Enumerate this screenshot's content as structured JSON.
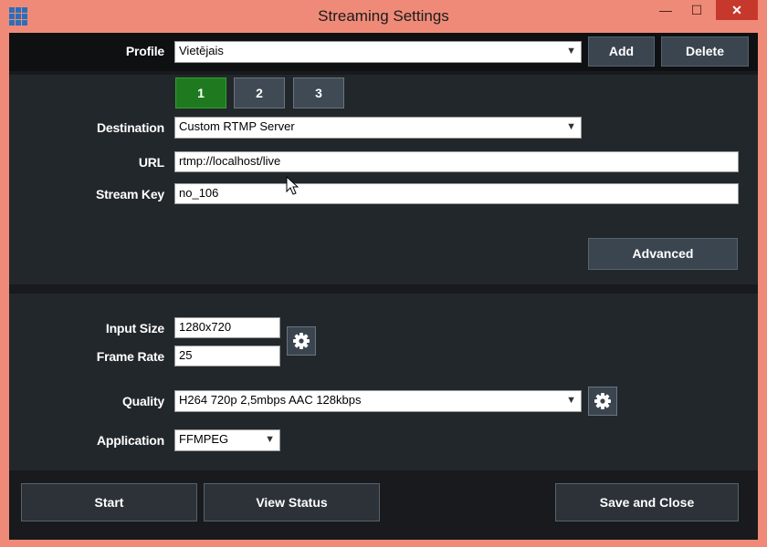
{
  "window": {
    "title": "Streaming Settings",
    "minimize_glyph": "—",
    "maximize_glyph": "☐",
    "close_glyph": "✕"
  },
  "profile": {
    "label": "Profile",
    "value": "Vietējais",
    "add_label": "Add",
    "delete_label": "Delete"
  },
  "tabs": [
    {
      "label": "1",
      "active": true
    },
    {
      "label": "2",
      "active": false
    },
    {
      "label": "3",
      "active": false
    }
  ],
  "destination": {
    "label": "Destination",
    "value": "Custom RTMP Server"
  },
  "url": {
    "label": "URL",
    "value": "rtmp://localhost/live"
  },
  "stream_key": {
    "label": "Stream Key",
    "value": "no_106"
  },
  "advanced_label": "Advanced",
  "input_size": {
    "label": "Input Size",
    "value": "1280x720"
  },
  "frame_rate": {
    "label": "Frame Rate",
    "value": "25"
  },
  "quality": {
    "label": "Quality",
    "value": "H264 720p 2,5mbps AAC 128kbps"
  },
  "application": {
    "label": "Application",
    "value": "FFMPEG"
  },
  "footer": {
    "start_label": "Start",
    "view_status_label": "View Status",
    "save_close_label": "Save and Close"
  },
  "colors": {
    "accent_green": "#1f7a1f",
    "frame": "#f08a78",
    "close_red": "#c7382c"
  },
  "icons": {
    "app": "grid-icon",
    "settings": "gear-icon",
    "dropdown": "chevron-down-icon"
  }
}
